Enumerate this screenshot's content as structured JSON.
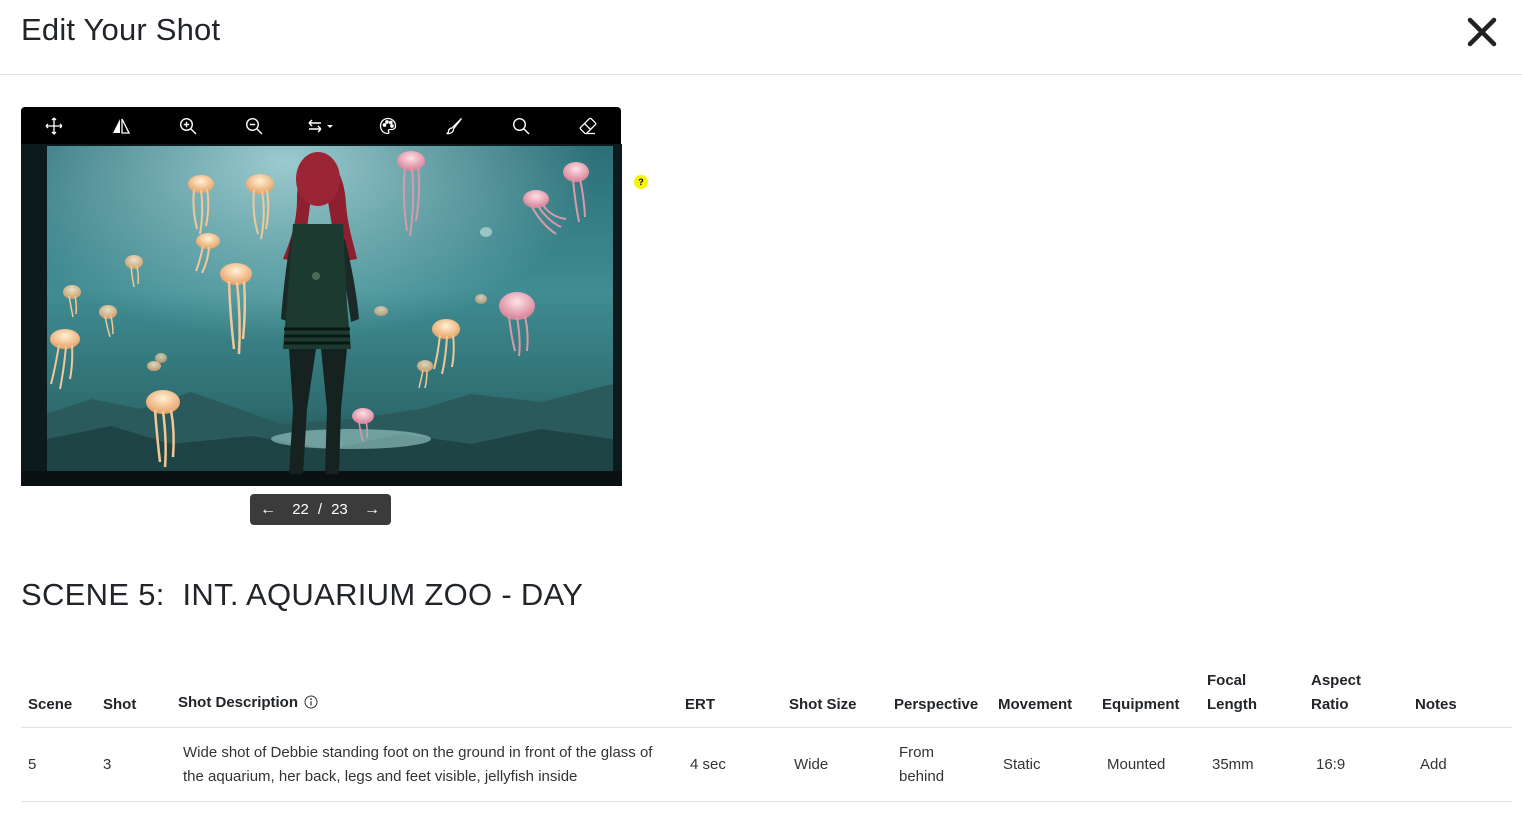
{
  "header": {
    "title": "Edit Your Shot"
  },
  "pager": {
    "current": "22",
    "separator": "/",
    "total": "23"
  },
  "help": {
    "label": "?"
  },
  "scene": {
    "heading": "SCENE 5:  INT. AQUARIUM ZOO - DAY"
  },
  "table": {
    "headers": {
      "scene": "Scene",
      "shot": "Shot",
      "description": "Shot Description",
      "ert": "ERT",
      "size": "Shot Size",
      "perspective": "Perspective",
      "movement": "Movement",
      "equipment": "Equipment",
      "focal": "Focal Length",
      "aspect": "Aspect Ratio",
      "notes": "Notes"
    },
    "row": {
      "scene": "5",
      "shot": "3",
      "description": "Wide shot of Debbie standing foot on the ground in front of the glass of the aquarium, her back, legs and feet visible, jellyfish inside",
      "ert": "4 sec",
      "size": "Wide",
      "perspective": "From behind",
      "movement": "Static",
      "equipment": "Mounted",
      "focal": "35mm",
      "aspect": "16:9",
      "notes": "Add"
    }
  },
  "toolbar_icons": [
    "move-icon",
    "flip-icon",
    "zoom-in-icon",
    "zoom-out-icon",
    "swap-dropdown-icon",
    "palette-icon",
    "brush-icon",
    "search-icon",
    "eraser-icon"
  ],
  "colors": {
    "toolbar_bg": "#000000",
    "pager_bg": "#3b3b3b",
    "help_dot": "#f5f500",
    "water": "#2f7f86"
  }
}
